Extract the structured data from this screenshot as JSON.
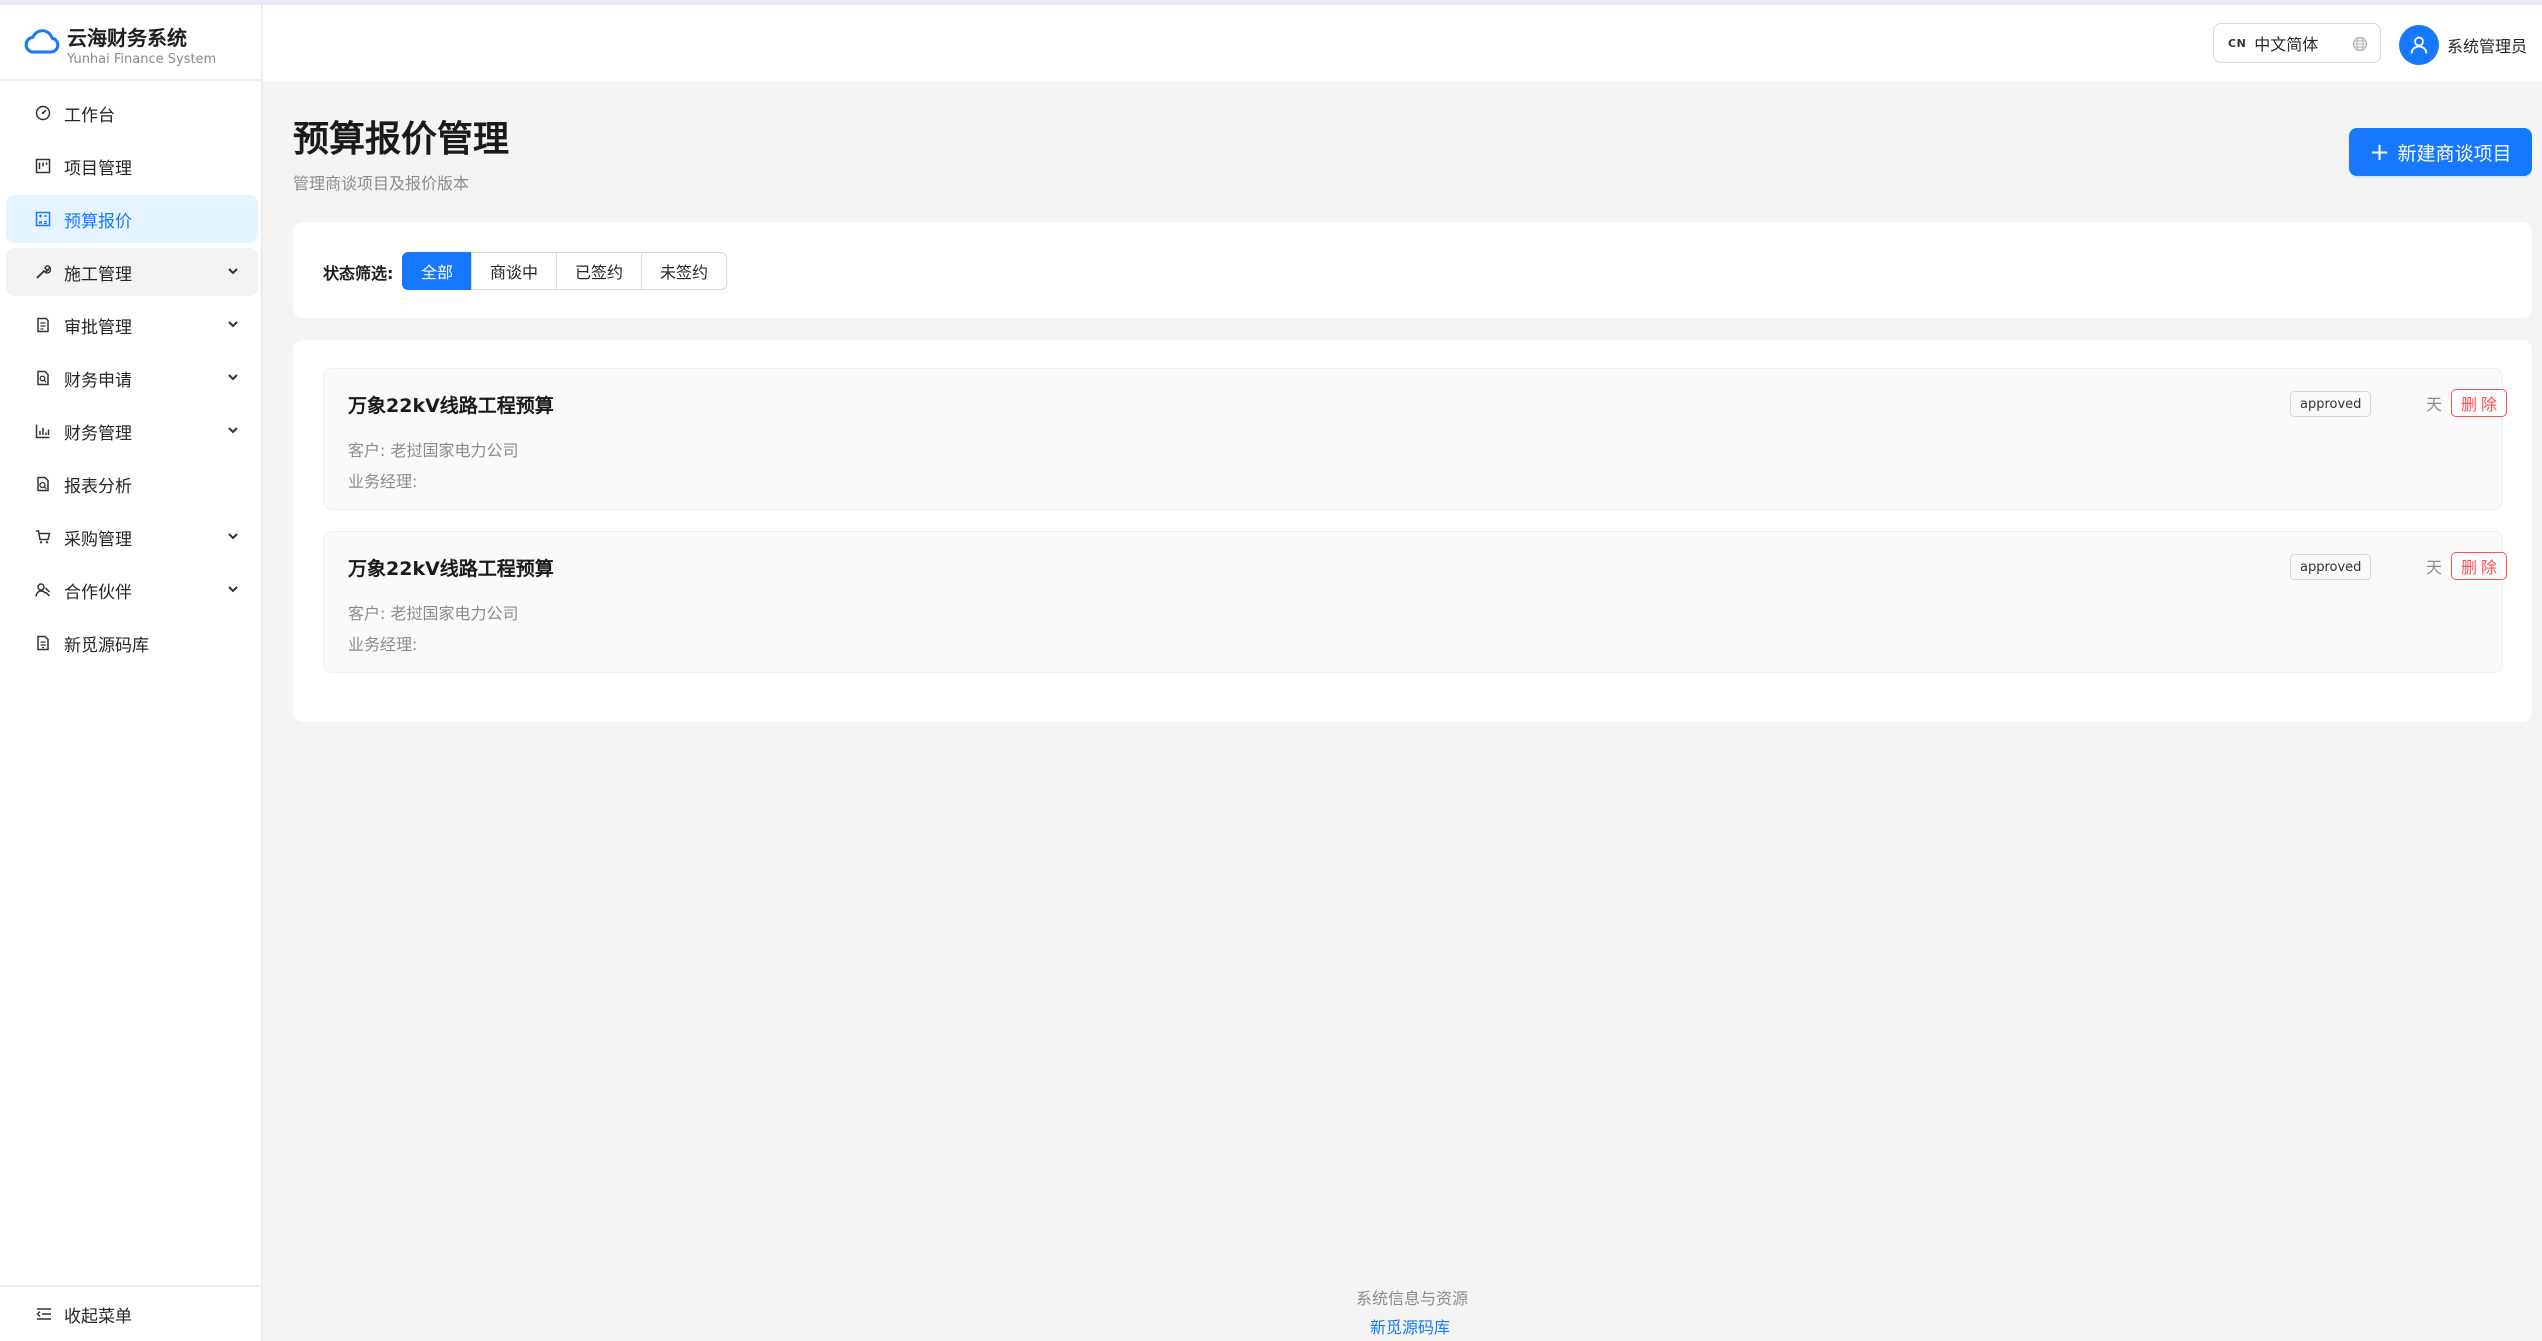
{
  "brand": {
    "title": "云海财务系统",
    "subtitle": "Yunhai Finance System"
  },
  "sidebar": {
    "items": [
      {
        "label": "工作台",
        "icon": "dashboard-icon",
        "expandable": false
      },
      {
        "label": "项目管理",
        "icon": "project-icon",
        "expandable": false
      },
      {
        "label": "预算报价",
        "icon": "calculator-icon",
        "expandable": false,
        "active": true
      },
      {
        "label": "施工管理",
        "icon": "tool-icon",
        "expandable": true,
        "open": true
      },
      {
        "label": "审批管理",
        "icon": "audit-icon",
        "expandable": true
      },
      {
        "label": "财务申请",
        "icon": "file-search-icon",
        "expandable": true
      },
      {
        "label": "财务管理",
        "icon": "bar-chart-icon",
        "expandable": true
      },
      {
        "label": "报表分析",
        "icon": "report-icon",
        "expandable": false
      },
      {
        "label": "采购管理",
        "icon": "cart-icon",
        "expandable": true
      },
      {
        "label": "合作伙伴",
        "icon": "partner-icon",
        "expandable": true
      },
      {
        "label": "新觅源码库",
        "icon": "repository-icon",
        "expandable": false
      }
    ],
    "collapse_label": "收起菜单"
  },
  "header": {
    "lang_code": "CN",
    "lang_label": "中文简体",
    "user_name": "系统管理员"
  },
  "main": {
    "title": "预算报价管理",
    "subtitle": "管理商谈项目及报价版本",
    "new_button": "新建商谈项目",
    "filter": {
      "label": "状态筛选:",
      "options": [
        "全部",
        "商谈中",
        "已签约",
        "未签约"
      ],
      "selected": "全部"
    },
    "projects": [
      {
        "name": "万象22kV线路工程预算",
        "client": "客户: 老挝国家电力公司",
        "manager": "业务经理:",
        "status": "approved",
        "days": "天",
        "delete": "删除"
      },
      {
        "name": "万象22kV线路工程预算",
        "client": "客户: 老挝国家电力公司",
        "manager": "业务经理:",
        "status": "approved",
        "days": "天",
        "delete": "删除"
      }
    ]
  },
  "footer": {
    "title": "系统信息与资源",
    "link": "新觅源码库"
  },
  "colors": {
    "primary": "#1677ff",
    "danger": "#ff4d4f",
    "active_bg": "#e6f4ff"
  }
}
